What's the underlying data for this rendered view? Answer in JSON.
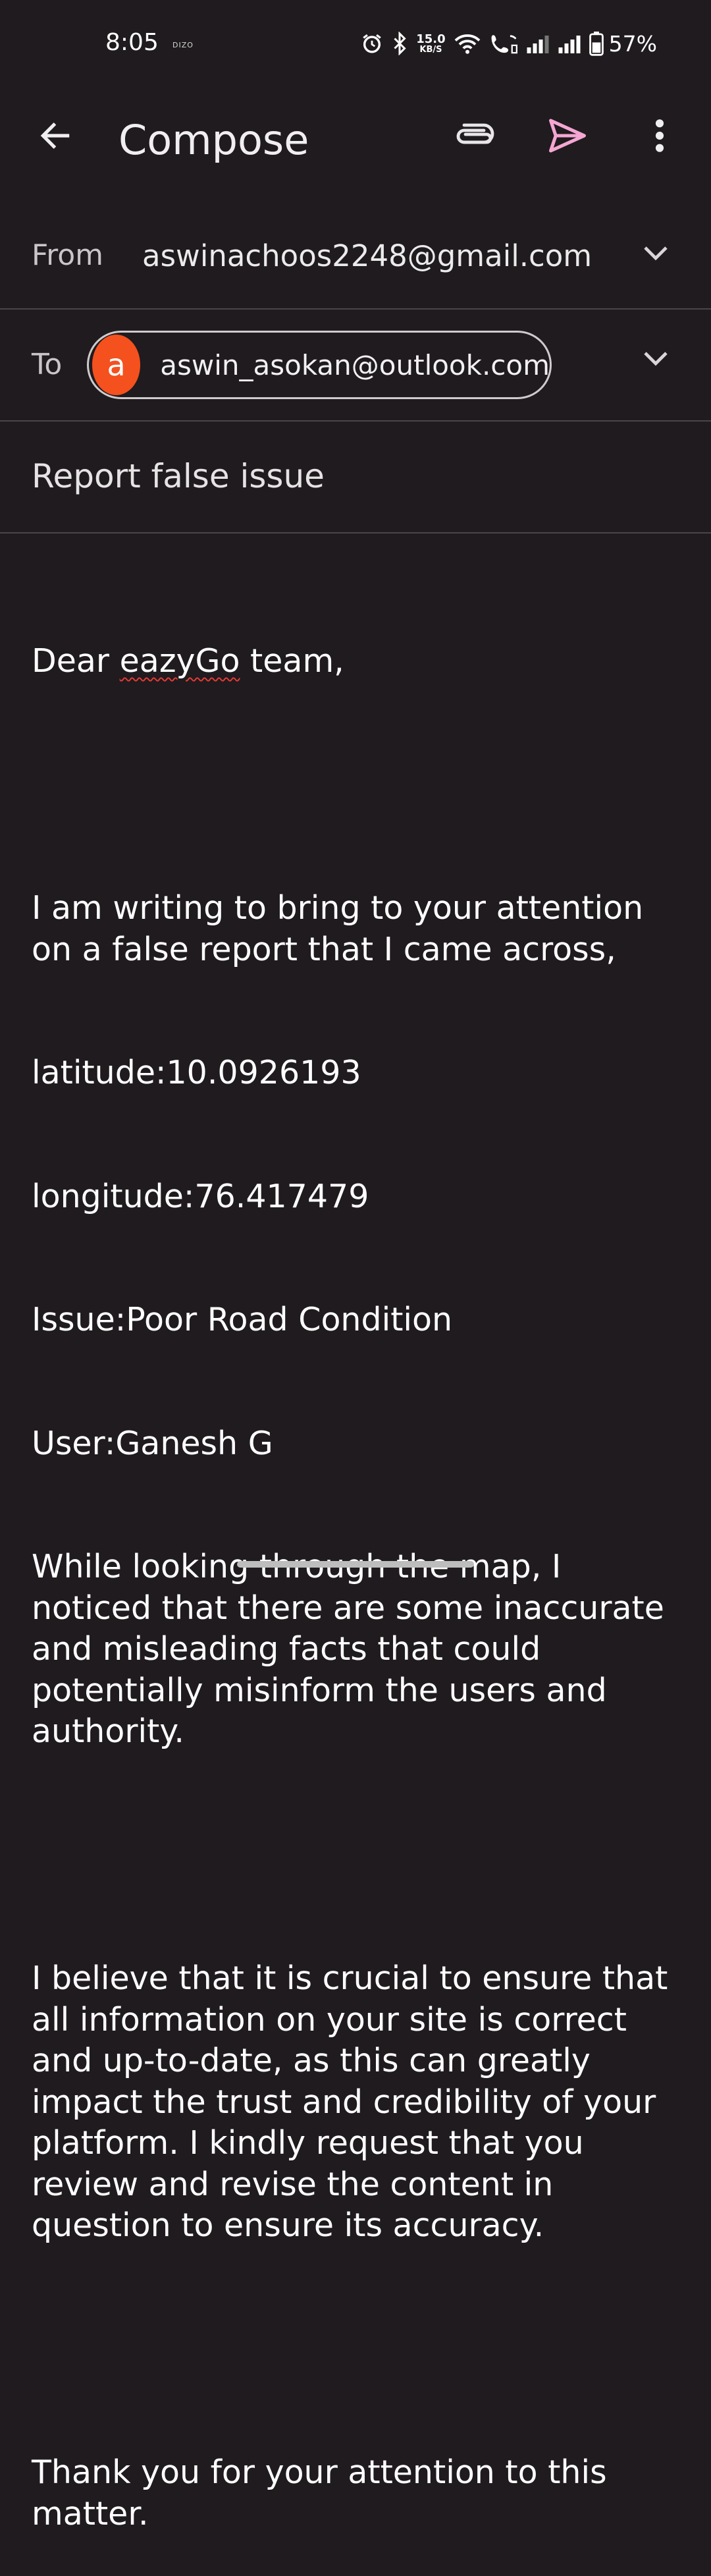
{
  "status_bar": {
    "time": "8:05",
    "carrier": "DIZO",
    "net_speed_value": "15.0",
    "net_speed_unit": "KB/S",
    "battery": "57%",
    "icons": [
      "alarm-icon",
      "bluetooth-icon",
      "wifi-icon",
      "wifi-calling-icon",
      "signal-icon",
      "signal-icon",
      "battery-icon"
    ]
  },
  "app_bar": {
    "title": "Compose",
    "icons": {
      "back": "arrow-back-icon",
      "attach": "paperclip-icon",
      "send": "send-icon",
      "more": "more-vert-icon"
    },
    "send_color": "#f5a6d3"
  },
  "from": {
    "label": "From",
    "value": "aswinachoos2248@gmail.com"
  },
  "to": {
    "label": "To",
    "recipients": [
      {
        "avatar_letter": "a",
        "avatar_color": "#f4511e",
        "email": "aswin_asokan@outlook.com"
      }
    ]
  },
  "subject": {
    "value": "Report false issue"
  },
  "body": {
    "greeting_prefix": "Dear ",
    "greeting_word": "eazyGo",
    "greeting_suffix": " team,",
    "lines": [
      "I am writing to bring to your attention on a false report that I came across,",
      "latitude:10.0926193",
      "longitude:76.417479",
      "Issue:Poor Road Condition",
      "User:Ganesh G",
      "While looking through the map, I noticed that there are some inaccurate and misleading facts that could potentially misinform the users and authority."
    ],
    "paragraph2": "I believe that it is crucial to ensure that all information on your site is correct and up-to-date, as this can greatly impact the trust and credibility of your platform. I kindly request that you review and revise the content in question to ensure its accuracy.",
    "closing": "Thank you for your attention to this matter."
  }
}
